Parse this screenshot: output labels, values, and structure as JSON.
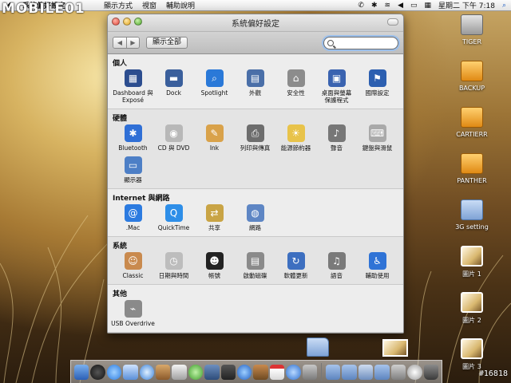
{
  "logo": "MOBILE01",
  "menubar": {
    "app": "系統偏好設定",
    "menus": [
      "顯示方式",
      "視窗",
      "輔助說明"
    ],
    "clock": "星期二 下午 7:18"
  },
  "window": {
    "title": "系統偏好設定",
    "show_all": "顯示全部",
    "search_placeholder": ""
  },
  "sections": [
    {
      "title": "個人",
      "items": [
        {
          "label": "Dashboard 與\nExposé",
          "icon": "dashboard-expose-icon",
          "color": "#2c4d8f",
          "glyph": "▦"
        },
        {
          "label": "Dock",
          "icon": "dock-icon",
          "color": "#3a5f9c",
          "glyph": "▬"
        },
        {
          "label": "Spotlight",
          "icon": "spotlight-icon",
          "color": "#2a79d8",
          "glyph": "⌕"
        },
        {
          "label": "外觀",
          "icon": "appearance-icon",
          "color": "#4a6fa8",
          "glyph": "▤"
        },
        {
          "label": "安全性",
          "icon": "security-icon",
          "color": "#8c8c8c",
          "glyph": "⌂"
        },
        {
          "label": "桌面與螢幕\n保護程式",
          "icon": "desktop-screensaver-icon",
          "color": "#3a63b0",
          "glyph": "▣"
        },
        {
          "label": "國際設定",
          "icon": "international-icon",
          "color": "#2c5fb0",
          "glyph": "⚑"
        }
      ]
    },
    {
      "title": "硬體",
      "items": [
        {
          "label": "Bluetooth",
          "icon": "bluetooth-icon",
          "color": "#2f6fd6",
          "glyph": "✱"
        },
        {
          "label": "CD 與 DVD",
          "icon": "cd-dvd-icon",
          "color": "#b8b8b8",
          "glyph": "◉"
        },
        {
          "label": "Ink",
          "icon": "ink-icon",
          "color": "#d9a24a",
          "glyph": "✎"
        },
        {
          "label": "列印與傳真",
          "icon": "print-fax-icon",
          "color": "#6d6d6d",
          "glyph": "⎙"
        },
        {
          "label": "能源節約器",
          "icon": "energy-saver-icon",
          "color": "#e8c34a",
          "glyph": "☀"
        },
        {
          "label": "聲音",
          "icon": "sound-icon",
          "color": "#777777",
          "glyph": "♪"
        },
        {
          "label": "鍵盤與滑鼠",
          "icon": "keyboard-mouse-icon",
          "color": "#a9a9a9",
          "glyph": "⌨"
        },
        {
          "label": "顯示器",
          "icon": "displays-icon",
          "color": "#4d7fc6",
          "glyph": "▭"
        }
      ]
    },
    {
      "title": "Internet 與網路",
      "items": [
        {
          "label": ".Mac",
          "icon": "dotmac-icon",
          "color": "#2c7be0",
          "glyph": "@"
        },
        {
          "label": "QuickTime",
          "icon": "quicktime-icon",
          "color": "#2e8ee8",
          "glyph": "Q"
        },
        {
          "label": "共享",
          "icon": "sharing-icon",
          "color": "#c9a445",
          "glyph": "⇄"
        },
        {
          "label": "網路",
          "icon": "network-icon",
          "color": "#5e86c4",
          "glyph": "◍"
        }
      ]
    },
    {
      "title": "系統",
      "items": [
        {
          "label": "Classic",
          "icon": "classic-icon",
          "color": "#c98a4e",
          "glyph": "☺"
        },
        {
          "label": "日期與時間",
          "icon": "date-time-icon",
          "color": "#bdbdbd",
          "glyph": "◷"
        },
        {
          "label": "帳號",
          "icon": "accounts-icon",
          "color": "#222222",
          "glyph": "☻"
        },
        {
          "label": "啟動磁碟",
          "icon": "startup-disk-icon",
          "color": "#8a8a8a",
          "glyph": "▤"
        },
        {
          "label": "軟體更新",
          "icon": "software-update-icon",
          "color": "#3d6fc0",
          "glyph": "↻"
        },
        {
          "label": "語音",
          "icon": "speech-icon",
          "color": "#7a7a7a",
          "glyph": "♫"
        },
        {
          "label": "輔助使用",
          "icon": "universal-access-icon",
          "color": "#2f73d6",
          "glyph": "♿"
        }
      ]
    },
    {
      "title": "其他",
      "items": [
        {
          "label": "USB Overdrive",
          "icon": "usb-overdrive-icon",
          "color": "#8a8a8a",
          "glyph": "⌁"
        }
      ]
    }
  ],
  "desktop": [
    {
      "label": "TIGER",
      "kind": "drive"
    },
    {
      "label": "BACKUP",
      "kind": "orange"
    },
    {
      "label": "CARTIERR",
      "kind": "orange"
    },
    {
      "label": "PANTHER",
      "kind": "orange"
    },
    {
      "label": "3G setting",
      "kind": "folder"
    },
    {
      "label": "圖片 1",
      "kind": "photo"
    },
    {
      "label": "圖片 2",
      "kind": "photo"
    },
    {
      "label": "圖片 3",
      "kind": "photo"
    }
  ],
  "watermark": "#16818"
}
